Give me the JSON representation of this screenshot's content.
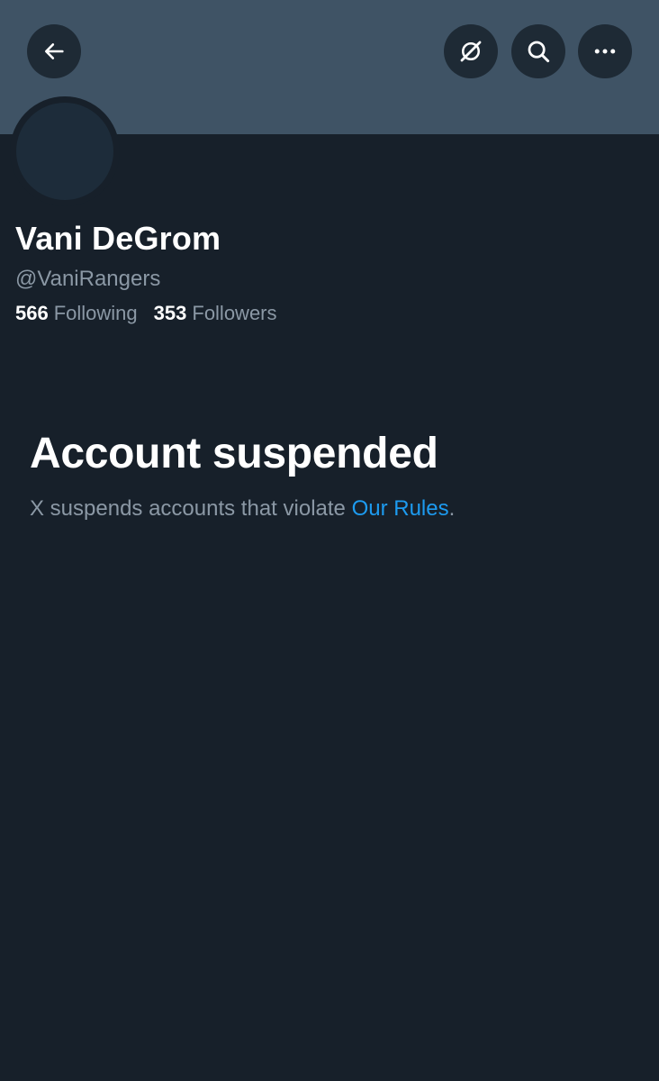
{
  "header": {
    "back_icon": "arrow-left-icon",
    "grok_icon": "grok-icon",
    "search_icon": "search-icon",
    "more_icon": "more-horizontal-icon"
  },
  "profile": {
    "display_name": "Vani DeGrom",
    "handle": "@VaniRangers",
    "following_count": "566",
    "following_label": "Following",
    "followers_count": "353",
    "followers_label": "Followers"
  },
  "suspension": {
    "title": "Account suspended",
    "text_prefix": "X suspends accounts that violate ",
    "link_text": "Our Rules",
    "text_suffix": "."
  },
  "colors": {
    "background": "#17202a",
    "banner": "#3f5365",
    "link": "#1d9bf0",
    "muted_text": "#8b98a5"
  }
}
